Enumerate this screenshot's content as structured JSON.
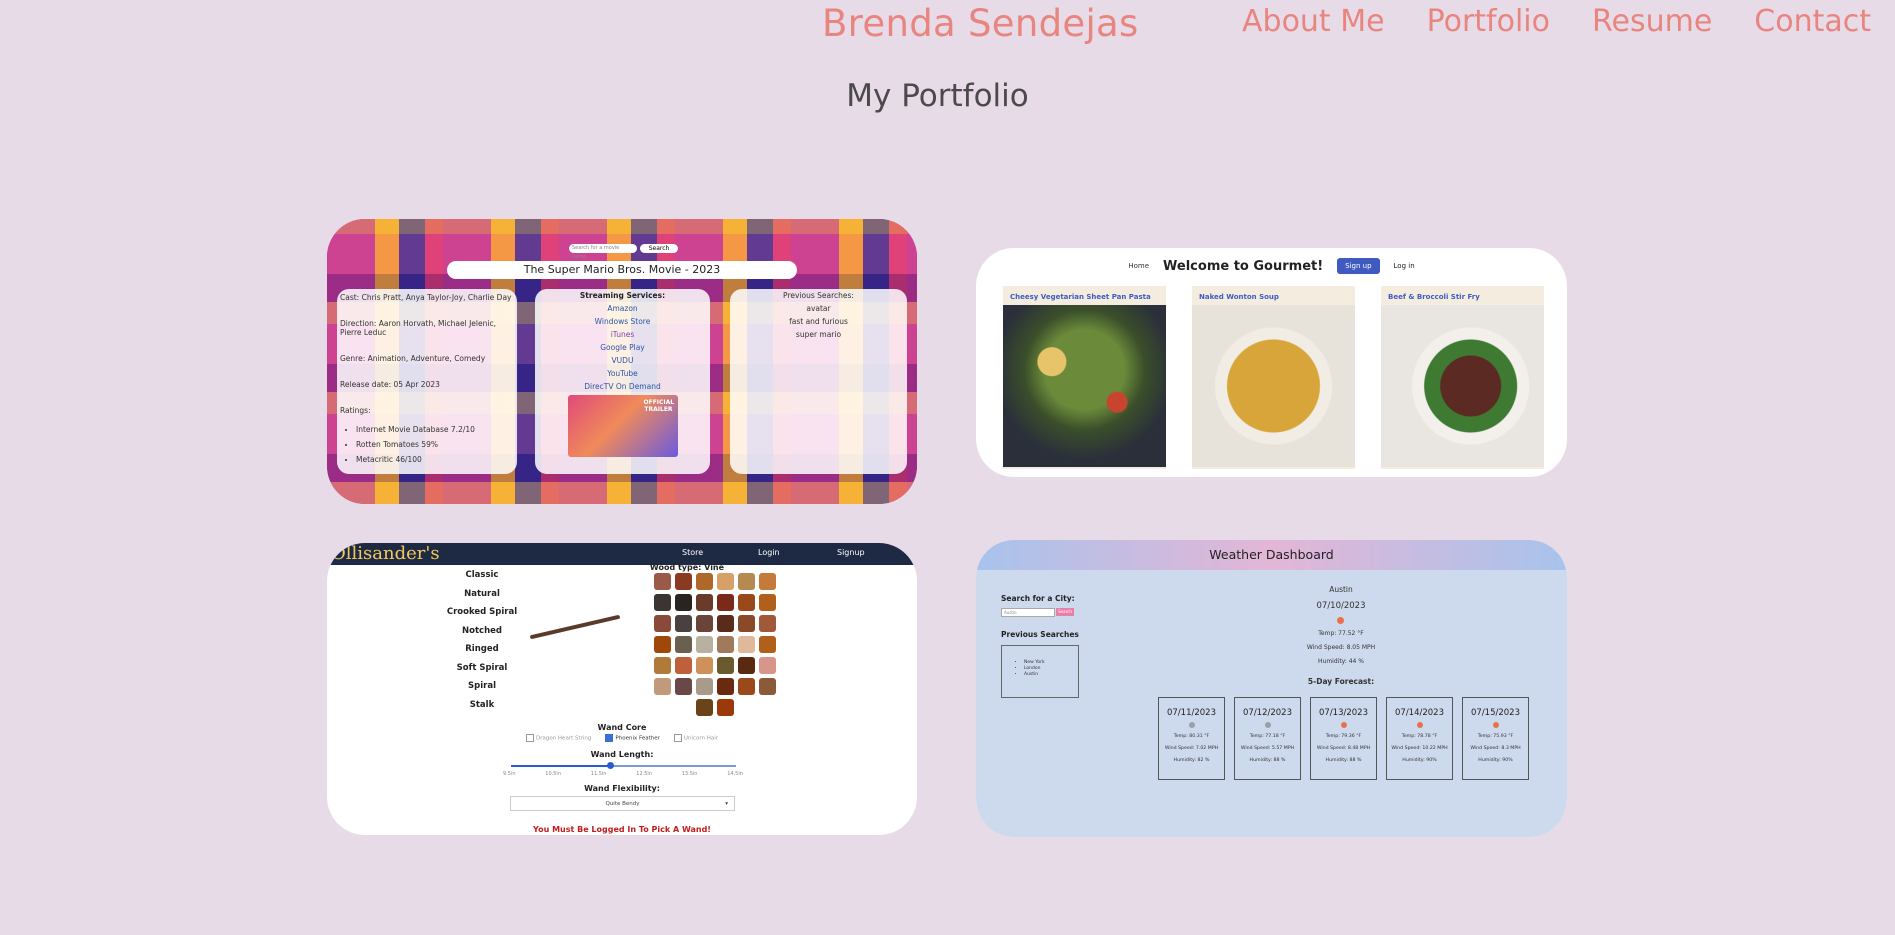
{
  "header": {
    "site_title": "Brenda Sendejas",
    "nav": [
      "About Me",
      "Portfolio",
      "Resume",
      "Contact"
    ]
  },
  "section_title": "My Portfolio",
  "colors": {
    "background": "#e8dbe8",
    "accent": "#e8857f",
    "heading": "#4a4a4a"
  },
  "projects": {
    "movie": {
      "search_placeholder": "Search for a movie name",
      "search_button": "Search",
      "title": "The Super Mario Bros. Movie - 2023",
      "cast": "Cast: Chris Pratt, Anya Taylor-Joy, Charlie Day",
      "direction": "Direction: Aaron Horvath, Michael Jelenic, Pierre Leduc",
      "genre": "Genre: Animation, Adventure, Comedy",
      "release": "Release date: 05 Apr 2023",
      "ratings_label": "Ratings:",
      "ratings": [
        "Internet Movie Database 7.2/10",
        "Rotten Tomatoes 59%",
        "Metacritic 46/100"
      ],
      "streaming_label": "Streaming Services:",
      "streaming": [
        "Amazon",
        "Windows Store",
        "iTunes",
        "Google Play",
        "VUDU",
        "YouTube",
        "DirecTV On Demand"
      ],
      "previous_label": "Previous Searches:",
      "previous": [
        "avatar",
        "fast and furious",
        "super mario"
      ]
    },
    "gourmet": {
      "home": "Home",
      "welcome": "Welcome to Gourmet!",
      "signup": "Sign up",
      "login": "Log in",
      "recipes": [
        "Cheesy Vegetarian Sheet Pan Pasta",
        "Naked Wonton Soup",
        "Beef & Broccoli Stir Fry"
      ]
    },
    "wands": {
      "logo": "Ollisander's",
      "nav": [
        "Store",
        "Login",
        "Signup"
      ],
      "styles": [
        "Classic",
        "Natural",
        "Crooked Spiral",
        "Notched",
        "Ringed",
        "Soft Spiral",
        "Spiral",
        "Stalk"
      ],
      "wood_type": "Wood type: Vine",
      "core_label": "Wand Core",
      "cores": [
        "Dragon Heart String",
        "Phoenix Feather",
        "Unicorn Hair"
      ],
      "length_label": "Wand Length:",
      "length_ticks": [
        "9.5in",
        "10.5in",
        "11.5in",
        "12.5in",
        "13.5in",
        "14.5in"
      ],
      "length_value_fraction": 0.44,
      "flex_label": "Wand Flexibility:",
      "flex_value": "Quite Bendy",
      "warning": "You Must Be Logged In To Pick A Wand!"
    },
    "weather": {
      "title": "Weather Dashboard",
      "search_label": "Search for a City:",
      "search_value": "Austin",
      "search_button": "Search",
      "previous_label": "Previous Searches",
      "previous": [
        "New York",
        "London",
        "Austin"
      ],
      "city": "Austin",
      "date": "07/10/2023",
      "temp": "Temp: 77.52 °F",
      "wind": "Wind Speed: 8.05 MPH",
      "humidity": "Humidity: 44 %",
      "forecast_label": "5-Day Forecast:",
      "forecast": [
        {
          "date": "07/11/2023",
          "temp": "Temp: 80.31 °F",
          "wind": "Wind Speed: 7.02 MPH",
          "humidity": "Humidity: 82 %"
        },
        {
          "date": "07/12/2023",
          "temp": "Temp: 77.18 °F",
          "wind": "Wind Speed: 5.57 MPH",
          "humidity": "Humidity: 88 %"
        },
        {
          "date": "07/13/2023",
          "temp": "Temp: 79.36 °F",
          "wind": "Wind Speed: 8.48 MPH",
          "humidity": "Humidity: 88 %"
        },
        {
          "date": "07/14/2023",
          "temp": "Temp: 78.78 °F",
          "wind": "Wind Speed: 10.22 MPH",
          "humidity": "Humidity: 90%"
        },
        {
          "date": "07/15/2023",
          "temp": "Temp: 75.93 °F",
          "wind": "Wind Speed: 8.3 MPH",
          "humidity": "Humidity: 90%"
        }
      ]
    }
  }
}
